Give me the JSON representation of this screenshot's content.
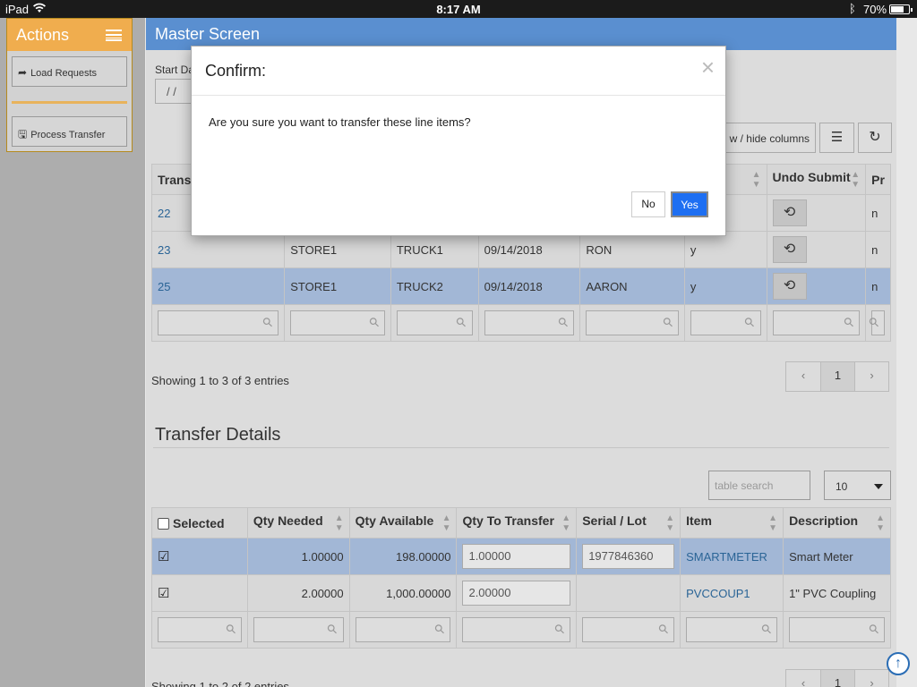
{
  "status_bar": {
    "device": "iPad",
    "time": "8:17 AM",
    "battery": "70%"
  },
  "sidebar": {
    "title": "Actions",
    "buttons": [
      {
        "label": "Load Requests",
        "icon": "share-arrow-icon"
      },
      {
        "label": "Process Transfer",
        "icon": "floppy-save-icon"
      }
    ]
  },
  "main": {
    "title": "Master Screen",
    "start_date_label": "Start Da",
    "start_date_value": "/  /",
    "show_hide_columns": "w / hide columns",
    "transfers_table": {
      "headers": [
        "Trans",
        "",
        "",
        "",
        "",
        "itted",
        "Undo Submit",
        "Pr"
      ],
      "rows": [
        [
          "22",
          "",
          "",
          "",
          "",
          "",
          "",
          "n"
        ],
        [
          "23",
          "STORE1",
          "TRUCK1",
          "09/14/2018",
          "RON",
          "y",
          "",
          "n"
        ],
        [
          "25",
          "STORE1",
          "TRUCK2",
          "09/14/2018",
          "AARON",
          "y",
          "",
          "n"
        ]
      ],
      "showing": "Showing 1 to 3 of 3 entries",
      "pager": [
        "‹",
        "1",
        "›"
      ]
    },
    "details": {
      "title": "Transfer Details",
      "search_placeholder": "table search",
      "page_size": "10",
      "headers": [
        "Selected",
        "Qty Needed",
        "Qty Available",
        "Qty To Transfer",
        "Serial / Lot",
        "Item",
        "Description"
      ],
      "rows": [
        {
          "qty_needed": "1.00000",
          "qty_available": "198.00000",
          "qty_to_transfer": "1.00000",
          "serial": "1977846360",
          "item": "SMARTMETER",
          "description": "Smart Meter"
        },
        {
          "qty_needed": "2.00000",
          "qty_available": "1,000.00000",
          "qty_to_transfer": "2.00000",
          "serial": "",
          "item": "PVCCOUP1",
          "description": "1\" PVC Coupling"
        }
      ],
      "showing": "Showing 1 to 2 of 2 entries",
      "pager": [
        "‹",
        "1",
        "›"
      ]
    }
  },
  "modal": {
    "title": "Confirm:",
    "message": "Are you sure you want to transfer these line items?",
    "no_label": "No",
    "yes_label": "Yes",
    "close": "×"
  },
  "colors": {
    "accent": "#5a8fd0",
    "actions": "#f0ad4e",
    "yes": "#1e6ff2"
  }
}
